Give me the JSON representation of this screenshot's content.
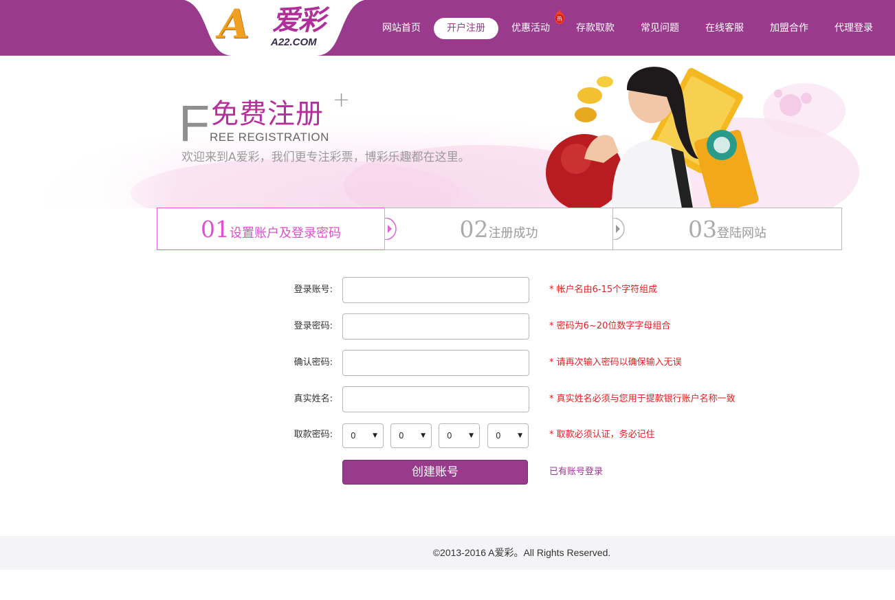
{
  "brand": {
    "logo_letter": "A",
    "logo_name": "爱彩",
    "logo_domain": "A22.COM",
    "logo_color": "#f0a020",
    "brand_color": "#9a3a8c"
  },
  "nav": {
    "items": [
      {
        "label": "网站首页"
      },
      {
        "label": "开户注册",
        "active": true
      },
      {
        "label": "优惠活动",
        "badge": "热"
      },
      {
        "label": "存款取款"
      },
      {
        "label": "常见问题"
      },
      {
        "label": "在线客服"
      },
      {
        "label": "加盟合作"
      },
      {
        "label": "代理登录"
      }
    ],
    "hot_badge_icon": "fire-icon"
  },
  "banner": {
    "big_letter": "F",
    "title": "免费注册",
    "subtitle": "REE REGISTRATION",
    "welcome": "欢迎来到A爱彩，我们更专注彩票，博彩乐趣都在这里。"
  },
  "steps": [
    {
      "num": "01",
      "label": "设置账户及登录密码",
      "active": true
    },
    {
      "num": "02",
      "label": "注册成功"
    },
    {
      "num": "03",
      "label": "登陆网站"
    }
  ],
  "form": {
    "fields": [
      {
        "label": "登录账号:",
        "value": "",
        "hint": "* 帐户名由6-15个字符组成"
      },
      {
        "label": "登录密码:",
        "value": "",
        "hint": "* 密码为6~20位数字字母组合"
      },
      {
        "label": "确认密码:",
        "value": "",
        "hint": "* 请再次输入密码以确保输入无误"
      },
      {
        "label": "真实姓名:",
        "value": "",
        "hint": "* 真实姓名必须与您用于提款银行账户名称一致"
      }
    ],
    "withdraw": {
      "label": "取款密码:",
      "digits": [
        "0",
        "0",
        "0",
        "0"
      ],
      "hint": "* 取款必须认证，务必记住"
    },
    "submit_label": "创建账号",
    "login_link": "已有账号登录"
  },
  "footer": {
    "copyright": "©2013-2016 A爱彩。All Rights Reserved."
  }
}
